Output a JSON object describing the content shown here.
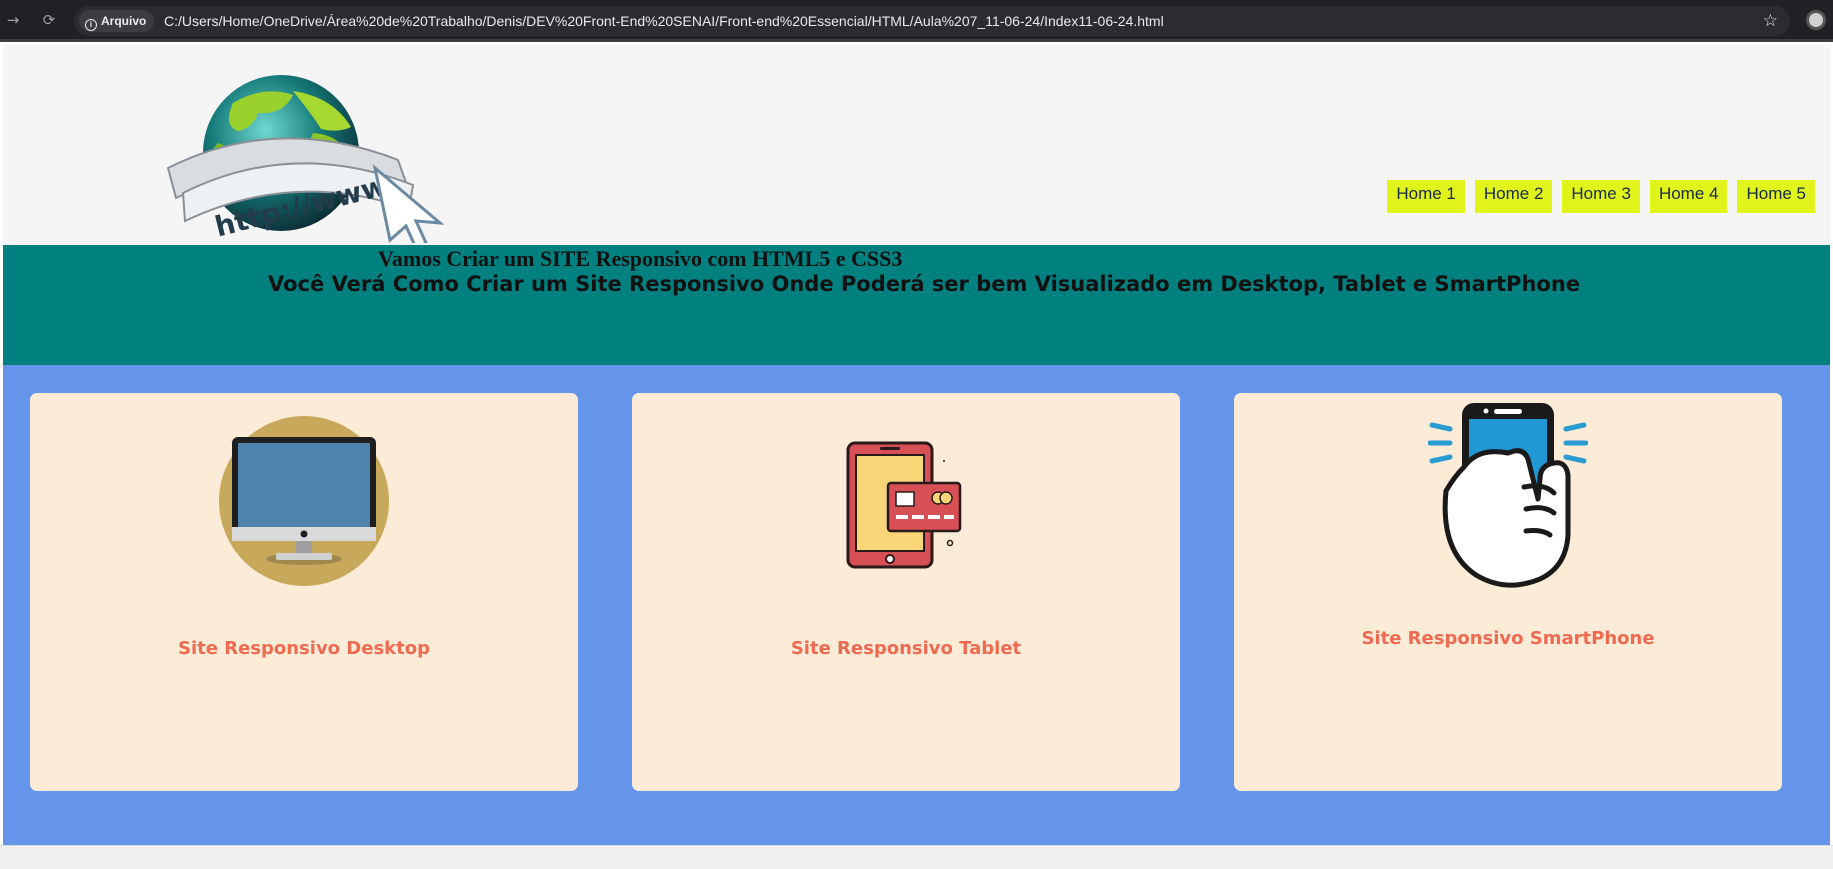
{
  "browser": {
    "security_chip": "Arquivo",
    "url": "C:/Users/Home/OneDrive/Área%20de%20Trabalho/Denis/DEV%20Front-End%20SENAI/Front-end%20Essencial/HTML/Aula%207_11-06-24/Index11-06-24.html",
    "icons": [
      "forward-icon",
      "reload-icon",
      "info-icon",
      "star-icon"
    ]
  },
  "header": {
    "logo_text": "http://www.",
    "menu": [
      "Home 1",
      "Home 2",
      "Home 3",
      "Home 4",
      "Home 5"
    ],
    "menu_color": "#e0f31a"
  },
  "banner": {
    "title": "Vamos Criar um SITE Responsivo com HTML5 e CSS3",
    "subtitle": "Você Verá Como Criar um Site Responsivo Onde Poderá ser bem Visualizado em Desktop, Tablet e SmartPhone",
    "color": "#018080"
  },
  "cards": [
    {
      "label": "Site Responsivo Desktop",
      "icon": "desktop-monitor-icon"
    },
    {
      "label": "Site Responsivo Tablet",
      "icon": "tablet-card-icon"
    },
    {
      "label": "Site Responsivo SmartPhone",
      "icon": "smartphone-hand-icon"
    }
  ],
  "colors": {
    "content_bg": "#6696ec",
    "card_bg": "#fbebd7",
    "card_label": "#ee6a50"
  }
}
